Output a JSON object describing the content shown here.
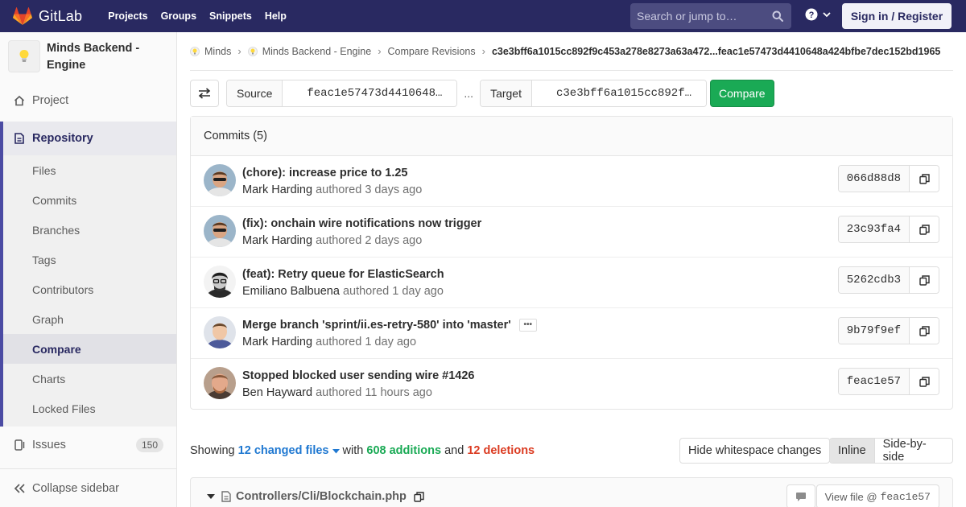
{
  "navbar": {
    "brand": "GitLab",
    "links": [
      "Projects",
      "Groups",
      "Snippets",
      "Help"
    ],
    "search_placeholder": "Search or jump to…",
    "signin_label": "Sign in / Register",
    "colors": {
      "bg": "#292961",
      "search_bg": "#4c4c80"
    }
  },
  "sidebar": {
    "project_name": "Minds Backend - Engine",
    "project_item": "Project",
    "repository_label": "Repository",
    "repository_items": [
      "Files",
      "Commits",
      "Branches",
      "Tags",
      "Contributors",
      "Graph",
      "Compare",
      "Charts",
      "Locked Files"
    ],
    "active_item": "Compare",
    "issues_label": "Issues",
    "issues_count": "150",
    "collapse_label": "Collapse sidebar"
  },
  "breadcrumb": {
    "items": [
      "Minds",
      "Minds Backend - Engine",
      "Compare Revisions"
    ],
    "current": "c3e3bff6a1015cc892f9c453a278e8273a63a472...feac1e57473d4410648a424bfbe7dec152bd1965"
  },
  "compare": {
    "source_label": "Source",
    "source_value": "feac1e57473d4410648…",
    "dots": "...",
    "target_label": "Target",
    "target_value": "c3e3bff6a1015cc892f…",
    "compare_label": "Compare"
  },
  "commits": {
    "header": "Commits (5)",
    "items": [
      {
        "title": "(chore): increase price to 1.25",
        "author": "Mark Harding",
        "authored_word": "authored",
        "time": "3 days ago",
        "sha": "066d88d8",
        "avatar": "mark"
      },
      {
        "title": "(fix): onchain wire notifications now trigger",
        "author": "Mark Harding",
        "authored_word": "authored",
        "time": "2 days ago",
        "sha": "23c93fa4",
        "avatar": "mark"
      },
      {
        "title": "(feat): Retry queue for ElasticSearch",
        "author": "Emiliano Balbuena",
        "authored_word": "authored",
        "time": "1 day ago",
        "sha": "5262cdb3",
        "avatar": "emiliano"
      },
      {
        "title": "Merge branch 'sprint/ii.es-retry-580' into 'master'",
        "author": "Mark Harding",
        "authored_word": "authored",
        "time": "1 day ago",
        "sha": "9b79f9ef",
        "avatar": "mark2",
        "has_ellipsis": true
      },
      {
        "title": "Stopped blocked user sending wire #1426",
        "author": "Ben Hayward",
        "authored_word": "authored",
        "time": "11 hours ago",
        "sha": "feac1e57",
        "avatar": "ben"
      }
    ]
  },
  "stats": {
    "showing": "Showing",
    "files": "12 changed files",
    "with": "with",
    "additions": "608 additions",
    "and": "and",
    "deletions": "12 deletions",
    "hide_whitespace": "Hide whitespace changes",
    "inline": "Inline",
    "side_by_side": "Side-by-side",
    "colors": {
      "link": "#1f78d1",
      "add": "#1aaa55",
      "del": "#db3b21"
    }
  },
  "file": {
    "path": "Controllers/Cli/Blockchain.php",
    "view_file_label": "View file @",
    "view_file_sha": "feac1e57"
  }
}
